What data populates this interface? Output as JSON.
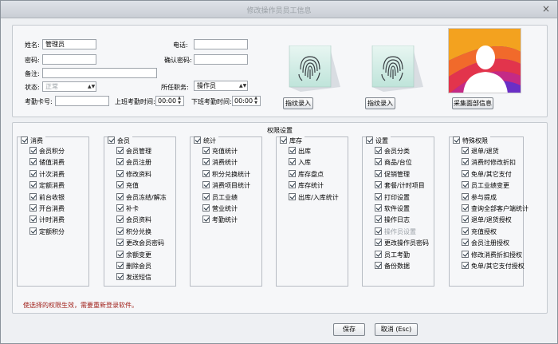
{
  "window": {
    "title": "修改操作员员工信息",
    "close_label": "×"
  },
  "form": {
    "name_label": "姓名:",
    "name_value": "管理员",
    "password_label": "密码:",
    "password_value": "",
    "note_label": "备注:",
    "note_value": "",
    "status_label": "状态:",
    "status_value": "正常",
    "card_label": "考勤卡号:",
    "card_value": "",
    "phone_label": "电话:",
    "phone_value": "",
    "confirm_label": "确认密码:",
    "confirm_value": "",
    "position_label": "所任职务:",
    "position_value": "操作员",
    "onduty_label": "上班考勤时间:",
    "onduty_value": "00:00",
    "offduty_label": "下班考勤时间:",
    "offduty_value": "00:00"
  },
  "buttons": {
    "fp1": "指纹录入",
    "fp2": "指纹录入",
    "face": "采集面部信息",
    "save": "保存",
    "cancel": "取消 (Esc)"
  },
  "permissions": {
    "title": "权限设置",
    "groups": [
      {
        "name": "消费",
        "items": [
          {
            "label": "会员积分",
            "checked": true
          },
          {
            "label": "储值消费",
            "checked": true
          },
          {
            "label": "计次消费",
            "checked": true
          },
          {
            "label": "定额消费",
            "checked": true
          },
          {
            "label": "前台收银",
            "checked": true
          },
          {
            "label": "开台消费",
            "checked": true
          },
          {
            "label": "计时消费",
            "checked": true
          },
          {
            "label": "定额积分",
            "checked": true
          }
        ]
      },
      {
        "name": "会员",
        "items": [
          {
            "label": "会员管理",
            "checked": true
          },
          {
            "label": "会员注册",
            "checked": true
          },
          {
            "label": "修改资料",
            "checked": true
          },
          {
            "label": "充值",
            "checked": true
          },
          {
            "label": "会员冻结/解冻",
            "checked": true
          },
          {
            "label": "补卡",
            "checked": true
          },
          {
            "label": "会员资料",
            "checked": true
          },
          {
            "label": "积分兑换",
            "checked": true
          },
          {
            "label": "更改会员密码",
            "checked": true
          },
          {
            "label": "余额变更",
            "checked": true
          },
          {
            "label": "删除会员",
            "checked": true
          },
          {
            "label": "发送短信",
            "checked": true
          }
        ]
      },
      {
        "name": "统计",
        "items": [
          {
            "label": "充值统计",
            "checked": true
          },
          {
            "label": "消费统计",
            "checked": true
          },
          {
            "label": "积分兑换统计",
            "checked": true
          },
          {
            "label": "消费项目统计",
            "checked": true
          },
          {
            "label": "员工业绩",
            "checked": true
          },
          {
            "label": "营业统计",
            "checked": true
          },
          {
            "label": "考勤统计",
            "checked": true
          }
        ]
      },
      {
        "name": "库存",
        "items": [
          {
            "label": "出库",
            "checked": true
          },
          {
            "label": "入库",
            "checked": true
          },
          {
            "label": "库存盘点",
            "checked": true
          },
          {
            "label": "库存统计",
            "checked": true
          },
          {
            "label": "出库/入库统计",
            "checked": true
          }
        ]
      },
      {
        "name": "设置",
        "items": [
          {
            "label": "会员分类",
            "checked": true
          },
          {
            "label": "商品/台位",
            "checked": true
          },
          {
            "label": "促销管理",
            "checked": true
          },
          {
            "label": "套餐/计时项目",
            "checked": true
          },
          {
            "label": "打印设置",
            "checked": true
          },
          {
            "label": "软件设置",
            "checked": true
          },
          {
            "label": "操作日志",
            "checked": true
          },
          {
            "label": "操作员设置",
            "checked": true,
            "disabled": true
          },
          {
            "label": "更改操作员密码",
            "checked": true
          },
          {
            "label": "员工考勤",
            "checked": true
          },
          {
            "label": "备份数据",
            "checked": true
          }
        ]
      },
      {
        "name": "特殊权限",
        "items": [
          {
            "label": "退单/退货",
            "checked": true
          },
          {
            "label": "消费时修改折扣",
            "checked": true
          },
          {
            "label": "免单/其它支付",
            "checked": true
          },
          {
            "label": "员工业绩变更",
            "checked": true
          },
          {
            "label": "参与提成",
            "checked": true
          },
          {
            "label": "查询全部客户端统计",
            "checked": true
          },
          {
            "label": "退单/退货授权",
            "checked": true
          },
          {
            "label": "充值授权",
            "checked": true
          },
          {
            "label": "会员注册授权",
            "checked": true
          },
          {
            "label": "修改消费折扣授权",
            "checked": true
          },
          {
            "label": "免单/其它支付授权",
            "checked": true
          }
        ]
      }
    ],
    "warning": "使选择的权限生效，需要重新登录软件。"
  },
  "colors": {
    "warning": "#a0201a",
    "face_gradient": [
      "#f6b42a",
      "#e0324a",
      "#7a3fd0"
    ]
  }
}
